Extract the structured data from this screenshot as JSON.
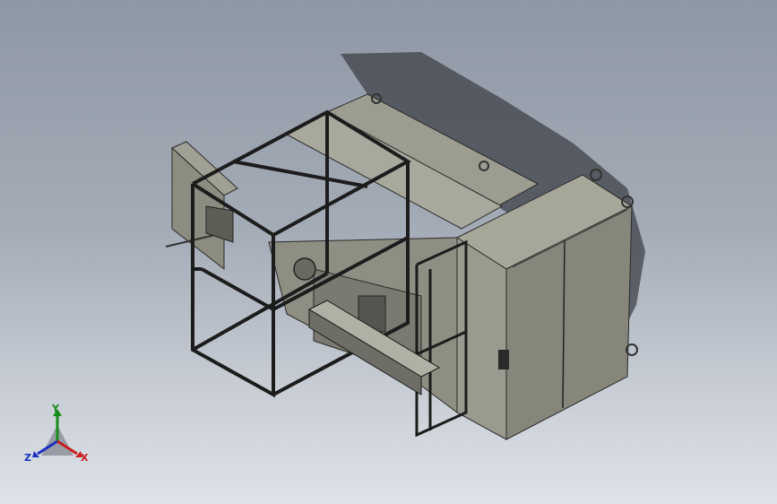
{
  "viewport": {
    "background_top": "#8e98a4",
    "background_bottom": "#dfe2e8",
    "model_color": "#8a8a80",
    "frame_color": "#1c1c1c"
  },
  "triad": {
    "y_label": "Y",
    "z_label": "Z",
    "x_label": "X",
    "colors": {
      "x": "#c81e1e",
      "y": "#1a8a1a",
      "z": "#1b2fc0"
    }
  }
}
